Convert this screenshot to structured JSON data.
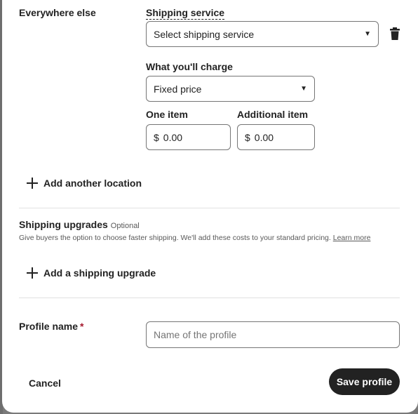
{
  "location": {
    "name": "Everywhere else"
  },
  "shipping_service": {
    "label": "Shipping service",
    "selected": "Select shipping service"
  },
  "charge": {
    "label": "What you'll charge",
    "selected": "Fixed price"
  },
  "one_item": {
    "label": "One item",
    "currency": "$",
    "value": "0.00"
  },
  "additional_item": {
    "label": "Additional item",
    "currency": "$",
    "value": "0.00"
  },
  "add_location": {
    "label": "Add another location"
  },
  "upgrades": {
    "title": "Shipping upgrades",
    "optional": "Optional",
    "description": "Give buyers the option to choose faster shipping. We'll add these costs to your standard pricing.",
    "learn_more": "Learn more",
    "add_label": "Add a shipping upgrade"
  },
  "profile": {
    "label": "Profile name",
    "required_mark": "*",
    "placeholder": "Name of the profile"
  },
  "actions": {
    "cancel": "Cancel",
    "save": "Save profile"
  },
  "icons": {
    "delete": "trash-icon",
    "dropdown": "chevron-down-icon",
    "add": "plus-icon"
  }
}
